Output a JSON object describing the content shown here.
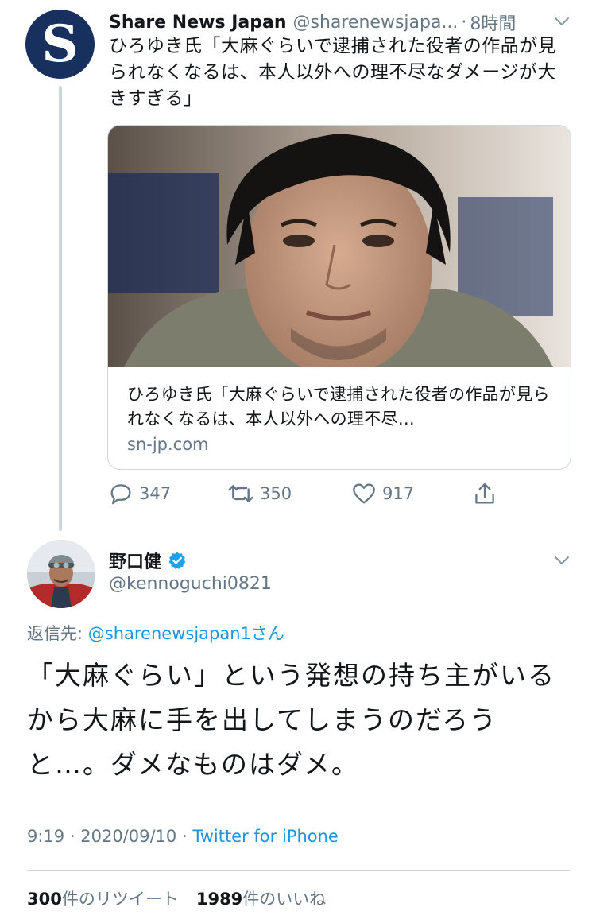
{
  "tweet1": {
    "avatar_letter": "S",
    "author_name": "Share News Japan",
    "author_handle": "@sharenewsjapa...",
    "separator": "·",
    "time": "8時間",
    "text": "ひろゆき氏「大麻ぐらいで逮捕された役者の作品が見られなくなるは、本人以外への理不尽なダメージが大きすぎる」",
    "card": {
      "title": "ひろゆき氏「大麻ぐらいで逮捕された役者の作品が見られなくなるは、本人以外への理不尽…",
      "domain": "sn-jp.com"
    },
    "actions": {
      "replies": "347",
      "retweets": "350",
      "likes": "917"
    },
    "icons": [
      "reply-icon",
      "retweet-icon",
      "like-icon",
      "share-icon",
      "chevron-down-icon"
    ]
  },
  "tweet2": {
    "author_name": "野口健",
    "author_handle": "@kennoguchi0821",
    "verified": true,
    "reply_label": "返信先:",
    "reply_handle": "@sharenewsjapan1",
    "reply_suffix": "さん",
    "text": "「大麻ぐらい」という発想の持ち主がいるから大麻に手を出してしまうのだろうと…。ダメなものはダメ。",
    "time": "9:19",
    "date": "2020/09/10",
    "meta_sep": "·",
    "source": "Twitter for iPhone",
    "retweet_count": "300",
    "retweet_label": "件のリツイート",
    "like_count": "1989",
    "like_label": "件のいいね"
  },
  "colors": {
    "link": "#1b95e0",
    "muted": "#657786",
    "border": "#ccd6dd",
    "verified": "#1da1f2",
    "avatar_bg": "#17305e"
  }
}
